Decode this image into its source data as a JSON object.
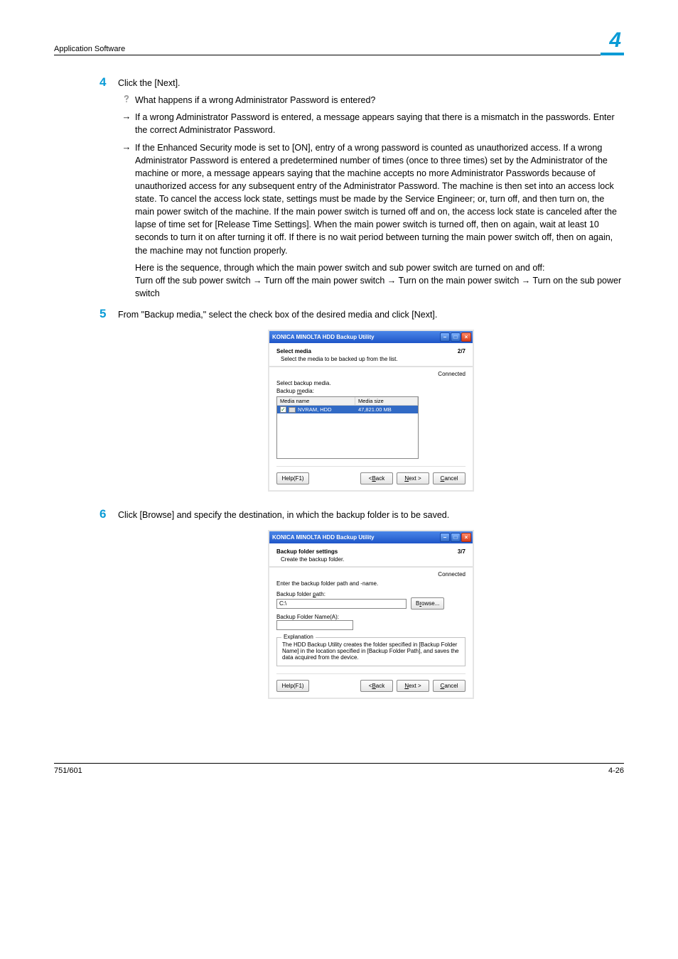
{
  "header": {
    "section": "Application Software",
    "chapter": "4"
  },
  "steps": {
    "s4": {
      "num": "4",
      "text": "Click the [Next].",
      "q_text": "What happens if a wrong Administrator Password is entered?",
      "a1": "If a wrong Administrator Password is entered, a message appears saying that there is a mismatch in the passwords. Enter the correct Administrator Password.",
      "a2": "If the Enhanced Security mode is set to [ON], entry of a wrong password is counted as unauthorized access. If a wrong Administrator Password is entered a predetermined number of times (once to three times) set by the Administrator of the machine or more, a message appears saying that the machine accepts no more Administrator Passwords because of unauthorized access for any subsequent entry of the Administrator Password. The machine is then set into an access lock state. To cancel the access lock state, settings must be made by the Service Engineer; or, turn off, and then turn on, the main power switch of the machine. If the main power switch is turned off and on, the access lock state is canceled after the lapse of time set for [Release Time Settings]. When the main power switch is turned off, then on again, wait at least 10 seconds to turn it on after turning it off. If there is no wait period between turning the main power switch off, then on again, the machine may not function properly.",
      "a2b": "Here is the sequence, through which the main power switch and sub power switch are turned on and off:",
      "a2c": "Turn off the sub power switch → Turn off the main power switch → Turn on the main power switch → Turn on the sub power switch"
    },
    "s5": {
      "num": "5",
      "text": "From \"Backup media,\" select the check box of the desired media and click [Next]."
    },
    "s6": {
      "num": "6",
      "text": "Click [Browse] and specify the destination, in which the backup folder is to be saved."
    }
  },
  "dlg1": {
    "title": "KONICA MINOLTA HDD Backup Utility",
    "h1": "Select media",
    "h2": "Select the media to be backed up from the list.",
    "step": "2/7",
    "connected": "Connected",
    "sec1": "Select backup media.",
    "sec2": "Backup media:",
    "col1": "Media name",
    "col2": "Media size",
    "row_name": "NVRAM, HDD",
    "row_size": "47,821.00 MB",
    "help": "Help(F1)",
    "back": "< Back",
    "next": "Next >",
    "cancel": "Cancel",
    "u_media": "m",
    "u_back": "B",
    "u_next": "N",
    "u_cancel": "C"
  },
  "dlg2": {
    "title": "KONICA MINOLTA HDD Backup Utility",
    "h1": "Backup folder settings",
    "h2": "Create the backup folder.",
    "step": "3/7",
    "connected": "Connected",
    "sec1": "Enter the backup folder path and -name.",
    "lbl_path": "Backup folder path:",
    "val_path": "C:\\",
    "browse": "Browse...",
    "lbl_name": "Backup Folder Name(A):",
    "group_title": "Explanation",
    "group_body": "The HDD Backup Utility creates the folder specified in [Backup Folder Name] in the location specified in [Backup Folder Path], and saves the data acquired from the device.",
    "help": "Help(F1)",
    "back": "< Back",
    "next": "Next >",
    "cancel": "Cancel",
    "u_path": "p",
    "u_browse": "r",
    "u_back": "B",
    "u_next": "N",
    "u_cancel": "C"
  },
  "footer": {
    "left": "751/601",
    "right": "4-26"
  }
}
